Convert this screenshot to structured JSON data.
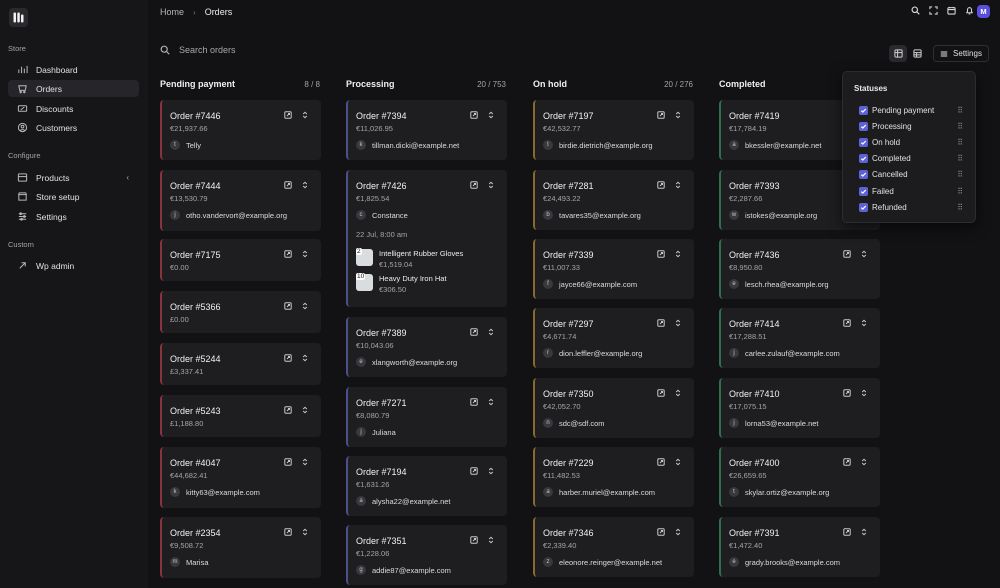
{
  "sidebar": {
    "section_store": "Store",
    "section_configure": "Configure",
    "section_custom": "Custom",
    "items": [
      {
        "label": "Dashboard",
        "icon": "dashboard-icon"
      },
      {
        "label": "Orders",
        "icon": "orders-icon",
        "active": true
      },
      {
        "label": "Discounts",
        "icon": "discount-icon"
      },
      {
        "label": "Customers",
        "icon": "customers-icon"
      },
      {
        "label": "Products",
        "icon": "products-icon"
      },
      {
        "label": "Store setup",
        "icon": "store-setup-icon"
      },
      {
        "label": "Settings",
        "icon": "settings-icon"
      },
      {
        "label": "Wp admin",
        "icon": "external-link-icon"
      }
    ]
  },
  "header": {
    "breadcrumb_home": "Home",
    "breadcrumb_sep": "›",
    "breadcrumb_current": "Orders",
    "avatar": "M"
  },
  "search": {
    "placeholder": "Search orders"
  },
  "toolbar": {
    "settings_label": "Settings"
  },
  "columns": [
    {
      "title": "Pending payment",
      "count": "8 / 8",
      "cards": [
        {
          "title": "Order #7446",
          "amount": "€21,937.66",
          "initial": "t",
          "customer": "Telly"
        },
        {
          "title": "Order #7444",
          "amount": "€13,530.79",
          "initial": "j",
          "customer": "otho.vandervort@example.org"
        },
        {
          "title": "Order #7175",
          "amount": "€0.00"
        },
        {
          "title": "Order #5366",
          "amount": "£0.00"
        },
        {
          "title": "Order #5244",
          "amount": "£3,337.41"
        },
        {
          "title": "Order #5243",
          "amount": "£1,188.80"
        },
        {
          "title": "Order #4047",
          "amount": "€44,682.41",
          "initial": "k",
          "customer": "kitty63@example.com"
        },
        {
          "title": "Order #2354",
          "amount": "€9,508.72",
          "initial": "m",
          "customer": "Marisa"
        }
      ]
    },
    {
      "title": "Processing",
      "count": "20 / 753",
      "cards": [
        {
          "title": "Order #7394",
          "amount": "€11,026.95",
          "initial": "k",
          "customer": "tillman.dicki@example.net"
        },
        {
          "title": "Order #7426",
          "amount": "€1,825.54",
          "initial": "c",
          "customer": "Constance",
          "date": "22 Jul, 8:00 am",
          "items": [
            {
              "qty": "2",
              "name": "Intelligent Rubber Gloves",
              "price": "€1,519.04"
            },
            {
              "qty": "10",
              "name": "Heavy Duty Iron Hat",
              "price": "€306.50"
            }
          ]
        },
        {
          "title": "Order #7389",
          "amount": "€10,043.06",
          "initial": "e",
          "customer": "xlangworth@example.org"
        },
        {
          "title": "Order #7271",
          "amount": "€8,080.79",
          "initial": "j",
          "customer": "Juliana"
        },
        {
          "title": "Order #7194",
          "amount": "€1,631.26",
          "initial": "a",
          "customer": "alysha22@example.net"
        },
        {
          "title": "Order #7351",
          "amount": "€1,228.06",
          "initial": "g",
          "customer": "addie87@example.com"
        }
      ]
    },
    {
      "title": "On hold",
      "count": "20 / 276",
      "cards": [
        {
          "title": "Order #7197",
          "amount": "€42,532.77",
          "initial": "t",
          "customer": "birdie.dietrich@example.org"
        },
        {
          "title": "Order #7281",
          "amount": "€24,493.22",
          "initial": "b",
          "customer": "tavares35@example.org"
        },
        {
          "title": "Order #7339",
          "amount": "€11,007.33",
          "initial": "f",
          "customer": "jayce66@example.com"
        },
        {
          "title": "Order #7297",
          "amount": "€4,671.74",
          "initial": "r",
          "customer": "dion.leffler@example.org"
        },
        {
          "title": "Order #7350",
          "amount": "€42,052.70",
          "initial": "n",
          "customer": "sdc@sdf.com"
        },
        {
          "title": "Order #7229",
          "amount": "€11,482.53",
          "initial": "a",
          "customer": "harber.muriel@example.com"
        },
        {
          "title": "Order #7346",
          "amount": "€2,339.40",
          "initial": "z",
          "customer": "eleonore.reinger@example.net"
        }
      ]
    },
    {
      "title": "Completed",
      "count": "",
      "cards": [
        {
          "title": "Order #7419",
          "amount": "€17,784.19",
          "initial": "a",
          "customer": "bkessler@example.net"
        },
        {
          "title": "Order #7393",
          "amount": "€2,287.66",
          "initial": "w",
          "customer": "istokes@example.org"
        },
        {
          "title": "Order #7436",
          "amount": "€8,950.80",
          "initial": "e",
          "customer": "lesch.rhea@example.org"
        },
        {
          "title": "Order #7414",
          "amount": "€17,288.51",
          "initial": "j",
          "customer": "carlee.zulauf@example.com"
        },
        {
          "title": "Order #7410",
          "amount": "€17,075.15",
          "initial": "j",
          "customer": "lorna53@example.net"
        },
        {
          "title": "Order #7400",
          "amount": "€26,659.65",
          "initial": "t",
          "customer": "skylar.ortiz@example.org"
        },
        {
          "title": "Order #7391",
          "amount": "€1,472.40",
          "initial": "e",
          "customer": "grady.brooks@example.com"
        }
      ]
    }
  ],
  "statuses_menu": {
    "title": "Statuses",
    "items": [
      "Pending payment",
      "Processing",
      "On hold",
      "Completed",
      "Cancelled",
      "Failed",
      "Refunded"
    ]
  },
  "colors": {
    "pending": "#8a3340",
    "processing": "#4b4f8a",
    "on_hold": "#8a6a2c",
    "completed": "#2f6f4c",
    "accent": "#5b63d6"
  }
}
